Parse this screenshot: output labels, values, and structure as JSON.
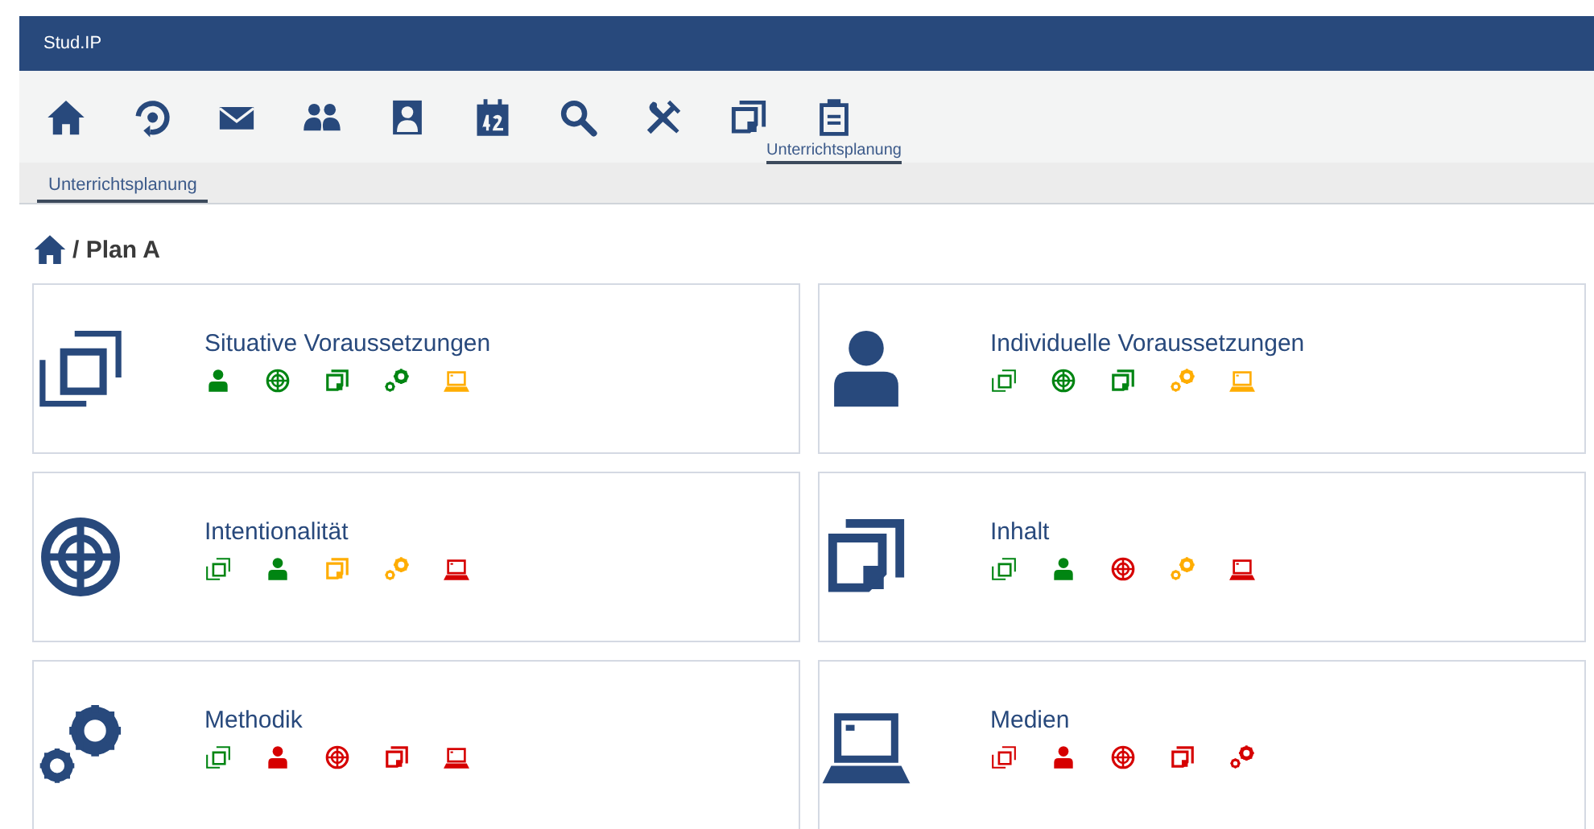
{
  "header": {
    "title": "Stud.IP"
  },
  "nav": [
    {
      "kind": "home"
    },
    {
      "kind": "activity"
    },
    {
      "kind": "mail"
    },
    {
      "kind": "community"
    },
    {
      "kind": "profile"
    },
    {
      "kind": "calendar"
    },
    {
      "kind": "search"
    },
    {
      "kind": "tools"
    },
    {
      "kind": "files"
    },
    {
      "kind": "clipboard",
      "label": "Unterrichtsplanung"
    }
  ],
  "tabs": [
    {
      "label": "Unterrichtsplanung",
      "selected": true
    }
  ],
  "breadcrumb": {
    "text": "/ Plan A"
  },
  "cards": [
    {
      "title": "Situative Voraussetzungen",
      "kind": "frame",
      "status": [
        {
          "kind": "person",
          "color": "#008512"
        },
        {
          "kind": "target",
          "color": "#008512"
        },
        {
          "kind": "pages",
          "color": "#008512"
        },
        {
          "kind": "gears",
          "color": "#008512"
        },
        {
          "kind": "laptop",
          "color": "#ffad00"
        }
      ]
    },
    {
      "title": "Individuelle Voraussetzungen",
      "kind": "person",
      "status": [
        {
          "kind": "frame",
          "color": "#008512"
        },
        {
          "kind": "target",
          "color": "#008512"
        },
        {
          "kind": "pages",
          "color": "#008512"
        },
        {
          "kind": "gears",
          "color": "#ffad00"
        },
        {
          "kind": "laptop",
          "color": "#ffad00"
        }
      ]
    },
    {
      "title": "Intentionalität",
      "kind": "target",
      "status": [
        {
          "kind": "frame",
          "color": "#008512"
        },
        {
          "kind": "person",
          "color": "#008512"
        },
        {
          "kind": "pages",
          "color": "#ffad00"
        },
        {
          "kind": "gears",
          "color": "#ffad00"
        },
        {
          "kind": "laptop",
          "color": "#d60000"
        }
      ]
    },
    {
      "title": "Inhalt",
      "kind": "pages",
      "status": [
        {
          "kind": "frame",
          "color": "#008512"
        },
        {
          "kind": "person",
          "color": "#008512"
        },
        {
          "kind": "target",
          "color": "#d60000"
        },
        {
          "kind": "gears",
          "color": "#ffad00"
        },
        {
          "kind": "laptop",
          "color": "#d60000"
        }
      ]
    },
    {
      "title": "Methodik",
      "kind": "gears",
      "status": [
        {
          "kind": "frame",
          "color": "#008512"
        },
        {
          "kind": "person",
          "color": "#d60000"
        },
        {
          "kind": "target",
          "color": "#d60000"
        },
        {
          "kind": "pages",
          "color": "#d60000"
        },
        {
          "kind": "laptop",
          "color": "#d60000"
        }
      ]
    },
    {
      "title": "Medien",
      "kind": "laptop",
      "status": [
        {
          "kind": "frame",
          "color": "#d60000"
        },
        {
          "kind": "person",
          "color": "#d60000"
        },
        {
          "kind": "target",
          "color": "#d60000"
        },
        {
          "kind": "pages",
          "color": "#d60000"
        },
        {
          "kind": "gears",
          "color": "#d60000"
        }
      ]
    }
  ]
}
